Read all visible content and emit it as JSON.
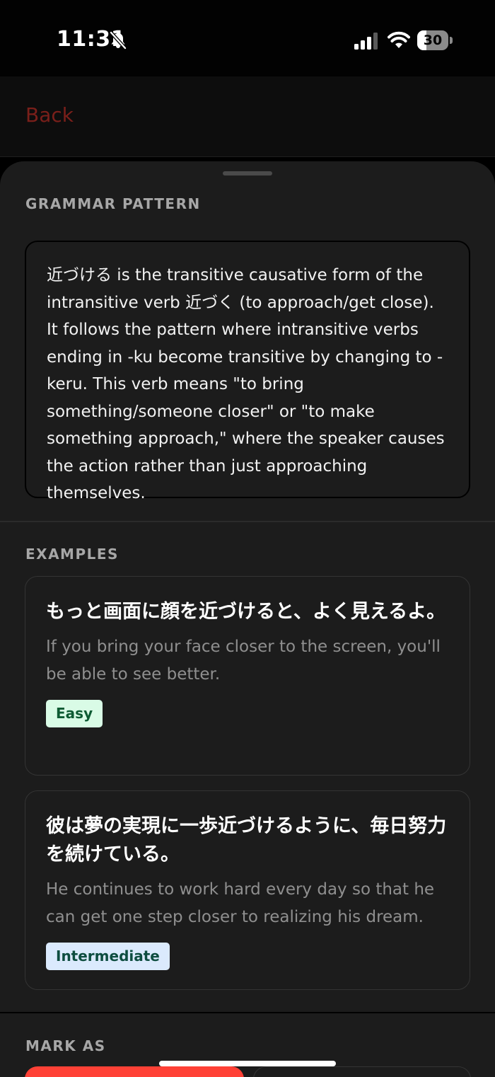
{
  "status_bar": {
    "time": "11:31",
    "battery_level": "30",
    "battery_fraction": 0.3,
    "icons": [
      "bell-slash-icon",
      "cellular-signal-icon",
      "wifi-icon",
      "battery-icon"
    ]
  },
  "nav": {
    "back_label": "Back",
    "back_color": "#7a1f1a"
  },
  "grammar": {
    "section_label": "GRAMMAR PATTERN",
    "description": "近づける is the transitive causative form of the intransitive verb 近づく (to approach/get close). It follows the pattern where intransitive verbs ending in -ku become transitive by changing to -keru. This verb means \"to bring something/someone closer\" or \"to make something approach,\" where the speaker causes the action rather than just approaching themselves."
  },
  "examples": {
    "section_label": "EXAMPLES",
    "items": [
      {
        "japanese": "もっと画面に顔を近づけると、よく見えるよ。",
        "english": "If you bring your face closer to the screen, you'll be able to see better.",
        "level": "Easy",
        "badge_bg": "#d9fbe6",
        "badge_fg": "#0e5b33"
      },
      {
        "japanese": "彼は夢の実現に一歩近づけるように、毎日努力を続けている。",
        "english": "He continues to work hard every day so that he can get one step closer to realizing his dream.",
        "level": "Intermediate",
        "badge_bg": "#dbeafd",
        "badge_fg": "#0e4d40"
      }
    ]
  },
  "mark_as": {
    "section_label": "MARK AS",
    "primary_color": "#ff4136"
  }
}
